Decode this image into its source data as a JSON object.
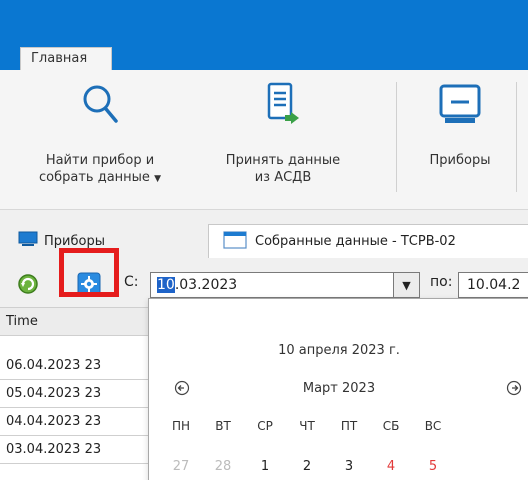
{
  "ribbon": {
    "tab_home": "Главная",
    "buttons": [
      {
        "label_line1": "Найти прибор и",
        "label_line2": "собрать данные",
        "icon": "search-icon",
        "has_dropdown": true
      },
      {
        "label_line1": "Принять данные",
        "label_line2": "из АСДВ",
        "icon": "document-import-icon"
      },
      {
        "label_line1": "Приборы",
        "label_line2": "",
        "icon": "device-icon"
      }
    ]
  },
  "doc_tabs": [
    {
      "label": "Приборы",
      "icon": "monitor-icon"
    },
    {
      "label": "Собранные данные - ТСРВ-02",
      "icon": "window-icon"
    }
  ],
  "toolbar": {
    "from_label": "С:",
    "from_value_selected": "10",
    "from_value_rest": ".03.2023",
    "to_label": "по:",
    "to_value": "10.04.2"
  },
  "grid": {
    "column_time": "Time",
    "rows": [
      "06.04.2023 23",
      "05.04.2023 23",
      "04.04.2023 23",
      "03.04.2023 23"
    ]
  },
  "calendar": {
    "today_label": "10 апреля 2023 г.",
    "month_label": "Март 2023",
    "weekdays": [
      "ПН",
      "ВТ",
      "СР",
      "ЧТ",
      "ПТ",
      "СБ",
      "ВС"
    ],
    "first_week": [
      "27",
      "28",
      "1",
      "2",
      "3",
      "4",
      "5"
    ]
  },
  "colors": {
    "brand_blue": "#0a77d1",
    "highlight_red": "#e51c1c",
    "selection_blue": "#1e63c8",
    "weekend_red": "#e23a3a"
  }
}
